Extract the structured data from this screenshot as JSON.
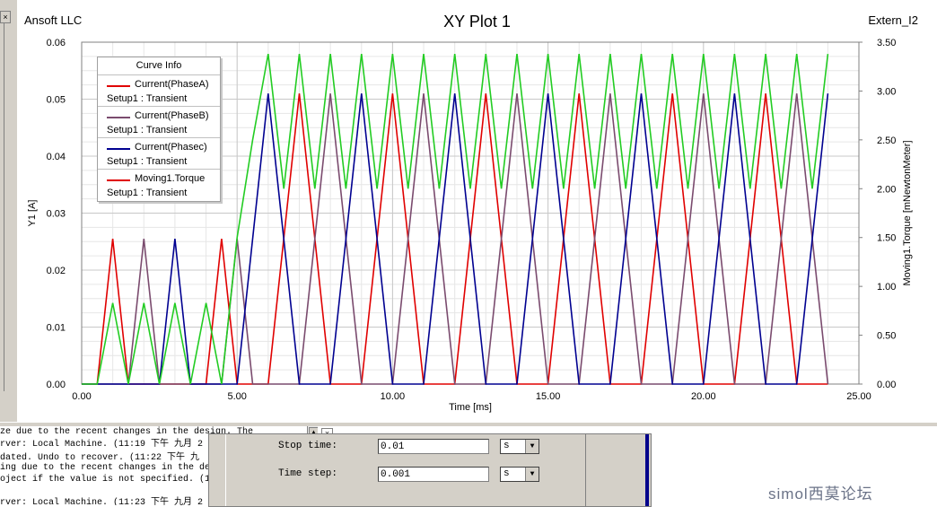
{
  "plot": {
    "company": "Ansoft LLC",
    "title": "XY Plot 1",
    "design": "Extern_I2"
  },
  "legend": {
    "title": "Curve Info",
    "items": [
      {
        "name": "Current(PhaseA)",
        "setup": "Setup1 : Transient",
        "color": "#e00000"
      },
      {
        "name": "Current(PhaseB)",
        "setup": "Setup1 : Transient",
        "color": "#7a4b6e"
      },
      {
        "name": "Current(Phasec)",
        "setup": "Setup1 : Transient",
        "color": "#000090"
      },
      {
        "name": "Moving1.Torque",
        "setup": "Setup1 : Transient",
        "color": "#e00000"
      }
    ]
  },
  "chart_data": {
    "type": "line",
    "title": "XY Plot 1",
    "xlabel": "Time [ms]",
    "ylabel": "Y1 [A]",
    "y2label": "Moving1.Torque [mNewtonMeter]",
    "xlim": [
      0,
      25
    ],
    "ylim": [
      0,
      0.06
    ],
    "y2lim": [
      0,
      3.5
    ],
    "xticks": [
      "0.00",
      "5.00",
      "10.00",
      "15.00",
      "20.00",
      "25.00"
    ],
    "yticks": [
      "0.00",
      "0.01",
      "0.02",
      "0.03",
      "0.04",
      "0.05",
      "0.06"
    ],
    "y2ticks": [
      "0.00",
      "0.50",
      "1.00",
      "1.50",
      "2.00",
      "2.50",
      "3.00",
      "3.50"
    ],
    "grid": true,
    "legend_position": "top-left",
    "series": [
      {
        "name": "Current(PhaseA)",
        "axis": "y1",
        "color": "#e00000",
        "x": [
          0,
          0.5,
          1,
          1.5,
          4,
          4.5,
          5,
          6,
          7,
          8,
          9,
          10,
          11,
          12,
          13,
          14,
          15,
          16,
          17,
          18,
          19,
          20,
          21,
          22,
          23,
          24
        ],
        "y": [
          0,
          0,
          0.0255,
          0,
          0,
          0.0255,
          0,
          0,
          0.051,
          0,
          0,
          0.051,
          0,
          0,
          0.051,
          0,
          0,
          0.051,
          0,
          0,
          0.051,
          0,
          0,
          0.051,
          0,
          0
        ]
      },
      {
        "name": "Current(PhaseB)",
        "axis": "y1",
        "color": "#7a4b6e",
        "x": [
          0,
          1.5,
          2,
          2.5,
          4.5,
          5,
          5.5,
          7,
          8,
          9,
          10,
          11,
          12,
          13,
          14,
          15,
          16,
          17,
          18,
          19,
          20,
          21,
          22,
          23,
          24
        ],
        "y": [
          0,
          0,
          0.0255,
          0,
          0,
          0.0255,
          0,
          0,
          0.051,
          0,
          0,
          0.051,
          0,
          0,
          0.051,
          0,
          0,
          0.051,
          0,
          0,
          0.051,
          0,
          0,
          0.051,
          0
        ]
      },
      {
        "name": "Current(Phasec)",
        "axis": "y1",
        "color": "#000090",
        "x": [
          0,
          2.5,
          3,
          3.5,
          5,
          6,
          7,
          8,
          9,
          10,
          11,
          12,
          13,
          14,
          15,
          16,
          17,
          18,
          19,
          20,
          21,
          22,
          23,
          24
        ],
        "y": [
          0,
          0,
          0.0255,
          0,
          0,
          0.051,
          0,
          0,
          0.051,
          0,
          0,
          0.051,
          0,
          0,
          0.051,
          0,
          0,
          0.051,
          0,
          0,
          0.051,
          0,
          0,
          0.051
        ]
      },
      {
        "name": "Moving1.Torque",
        "axis": "y2",
        "color": "#22cc22",
        "x": [
          0,
          0.5,
          1,
          1.5,
          2,
          2.5,
          3,
          3.5,
          4,
          4.5,
          5,
          5.5,
          6,
          6.5,
          7,
          7.5,
          8,
          8.5,
          9,
          9.5,
          10,
          10.5,
          11,
          11.5,
          12,
          12.5,
          13,
          13.5,
          14,
          14.5,
          15,
          15.5,
          16,
          16.5,
          17,
          17.5,
          18,
          18.5,
          19,
          19.5,
          20,
          20.5,
          21,
          21.5,
          22,
          22.5,
          23,
          23.5,
          24
        ],
        "y": [
          0,
          0,
          0.83,
          0,
          0.83,
          0,
          0.83,
          0,
          0.83,
          0,
          1.5,
          2.5,
          3.38,
          2.0,
          3.38,
          2.0,
          3.38,
          2.0,
          3.38,
          2.0,
          3.38,
          2.0,
          3.38,
          2.0,
          3.38,
          2.0,
          3.38,
          2.0,
          3.38,
          2.0,
          3.38,
          2.0,
          3.38,
          2.0,
          3.38,
          2.0,
          3.38,
          2.0,
          3.38,
          2.0,
          3.38,
          2.0,
          3.38,
          2.0,
          3.38,
          2.0,
          3.38,
          2.0,
          3.38
        ]
      }
    ]
  },
  "messages": {
    "lines": [
      "ze due to the recent changes in the design.  The",
      "rver: Local Machine. (11:19 下午  九月 2",
      "dated. Undo to recover. (11:22 下午  九",
      "ing due to the recent changes in the des",
      "oject if the value is not specified. (1",
      "rver: Local Machine. (11:23 下午  九月 2"
    ]
  },
  "dialog": {
    "stop_time_label": "Stop time:",
    "stop_time_value": "0.01",
    "stop_time_unit": "s",
    "time_step_label": "Time step:",
    "time_step_value": "0.001",
    "time_step_unit": "s"
  },
  "watermark": "simol西莫论坛"
}
